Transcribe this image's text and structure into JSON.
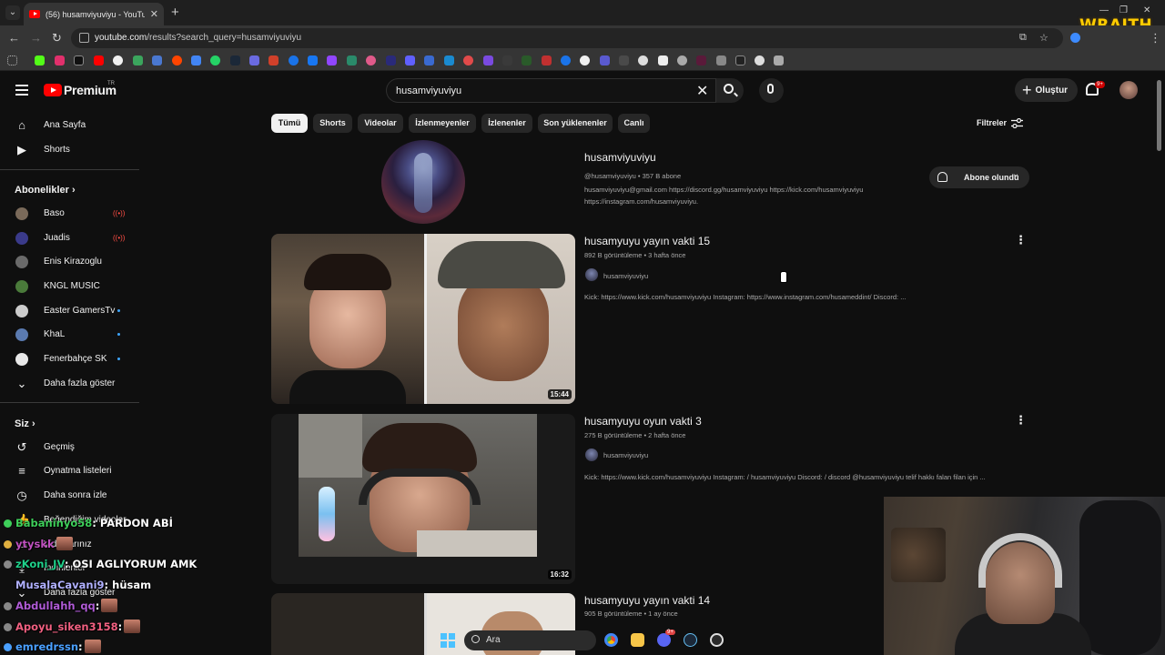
{
  "browser": {
    "tab_title": "(56) husamviyuviyu - YouTube",
    "url_domain": "youtube.com",
    "url_path": "/results?search_query=husamviyuviyu",
    "overlay_logo": "WRAITH"
  },
  "header": {
    "brand": "Premium",
    "region": "TR",
    "search_value": "husamviyuviyu",
    "create_label": "Oluştur",
    "notif_count": "9+"
  },
  "sidebar": {
    "main": [
      {
        "label": "Ana Sayfa",
        "icon": "home-icon"
      },
      {
        "label": "Shorts",
        "icon": "shorts-icon"
      }
    ],
    "subs_header": "Abonelikler",
    "subs": [
      {
        "label": "Baso",
        "live": true,
        "color": "#7a6a5a"
      },
      {
        "label": "Juadis",
        "live": true,
        "color": "#3a3a8a"
      },
      {
        "label": "Enis Kirazoglu",
        "live": false,
        "color": "#6a6a6a"
      },
      {
        "label": "KNGL MUSIC",
        "live": false,
        "color": "#4a7a3a"
      },
      {
        "label": "Easter GamersTv",
        "live": false,
        "color": "#cccccc"
      },
      {
        "label": "KhaL",
        "live": false,
        "color": "#5a7ab0"
      },
      {
        "label": "Fenerbahçe SK",
        "live": false,
        "color": "#e8e8e8"
      }
    ],
    "show_more": "Daha fazla göster",
    "you_header": "Siz",
    "you": [
      {
        "label": "Geçmiş",
        "icon": "history-icon"
      },
      {
        "label": "Oynatma listeleri",
        "icon": "playlists-icon"
      },
      {
        "label": "Daha sonra izle",
        "icon": "watch-later-icon"
      },
      {
        "label": "Beğendiğim videolar",
        "icon": "like-icon"
      },
      {
        "label": "Videolarınız",
        "icon": "your-videos-icon"
      },
      {
        "label": "İndirilenler",
        "icon": "downloads-icon"
      },
      {
        "label": "Daha fazla göster",
        "icon": "chevron-down-icon"
      }
    ]
  },
  "chips": [
    "Tümü",
    "Shorts",
    "Videolar",
    "İzlenmeyenler",
    "İzlenenler",
    "Son yüklenenler",
    "Canlı"
  ],
  "filters_label": "Filtreler",
  "channel": {
    "name": "husamviyuviyu",
    "meta": "@husamviyuviyu • 357 B abone",
    "desc_1": "husamviyuviyu@gmail.com https://discord.gg/husamviyuviyu https://kick.com/husamviyuviyu",
    "desc_2": "https://instagram.com/husamviyuviyu.",
    "subscribed_label": "Abone olundu"
  },
  "videos": [
    {
      "title": "husamyuyu yayın vakti 15",
      "meta": "892 B görüntüleme • 3 hafta önce",
      "channel": "husamviyuviyu",
      "desc": "Kick: https://www.kick.com/husamviyuviyu Instagram: https://www.instagram.com/husameddint/ Discord: ...",
      "duration": "15:44"
    },
    {
      "title": "husamyuyu oyun vakti 3",
      "meta": "275 B görüntüleme • 2 hafta önce",
      "channel": "husamviyuviyu",
      "desc": "Kick: https://www.kick.com/husamviyuviyu Instagram: / husamviyuviyu Discord: / discord @husamviyuviyu telif hakkı falan filan için ...",
      "duration": "16:32"
    },
    {
      "title": "husamyuyu yayın vakti 14",
      "meta": "905 B görüntüleme • 1 ay önce",
      "channel": "",
      "desc": "",
      "duration": ""
    }
  ],
  "chat": [
    {
      "user": "Babaninyo58",
      "msg": ": PARDON ABİ",
      "color": "#3ecf5a"
    },
    {
      "user": "ytyskk",
      "msg": "",
      "color": "#c050c0"
    },
    {
      "user": "zKoni_JV",
      "msg": ": OSI AGLIYORUM AMK",
      "color": "#1fd08a"
    },
    {
      "user": "MusalaCavani9",
      "msg": ": hüsam",
      "color": "#b0b0ff"
    },
    {
      "user": "Abdullahh_qq",
      "msg": ":",
      "color": "#b05bd6"
    },
    {
      "user": "Apoyu_siken3158",
      "msg": ":",
      "color": "#f06080"
    },
    {
      "user": "emredrssn",
      "msg": ":",
      "color": "#4aa0ff"
    }
  ],
  "taskbar": {
    "search_label": "Ara",
    "discord_badge": "9+"
  }
}
